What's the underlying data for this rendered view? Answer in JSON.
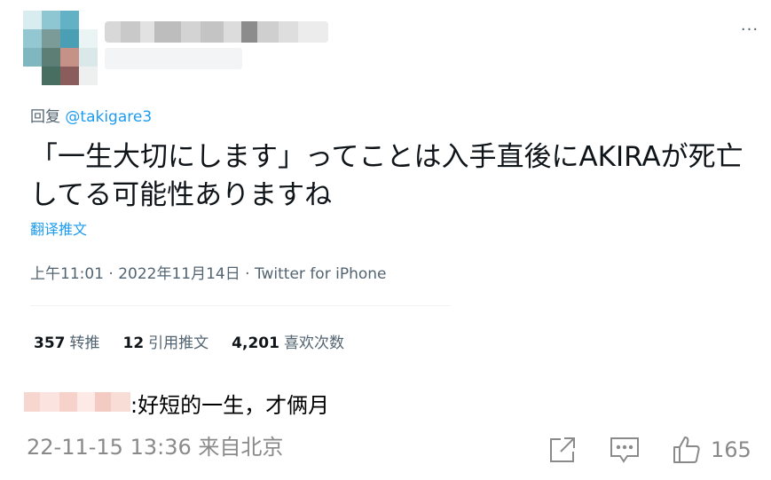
{
  "tweet": {
    "more_label": "···",
    "reply_prefix": "回复",
    "reply_handle": "@takigare3",
    "text": "「一生大切にします」ってことは入手直後にAKIRAが死亡してる可能性ありますね",
    "translate_label": "翻译推文",
    "meta": "上午11:01 · 2022年11月14日 · Twitter for iPhone",
    "stats": {
      "retweets_count": "357",
      "retweets_label": "转推",
      "quotes_count": "12",
      "quotes_label": "引用推文",
      "likes_count": "4,201",
      "likes_label": "喜欢次数"
    }
  },
  "comment": {
    "text": ":好短的一生，才俩月",
    "meta": "22-11-15 13:36 来自北京",
    "like_count": "165",
    "icons": [
      "share-icon",
      "comment-icon",
      "thumbs-up-icon"
    ]
  },
  "colors": {
    "link": "#1d9bf0",
    "secondary_text": "#536471",
    "comment_meta": "#8a8a8a"
  }
}
